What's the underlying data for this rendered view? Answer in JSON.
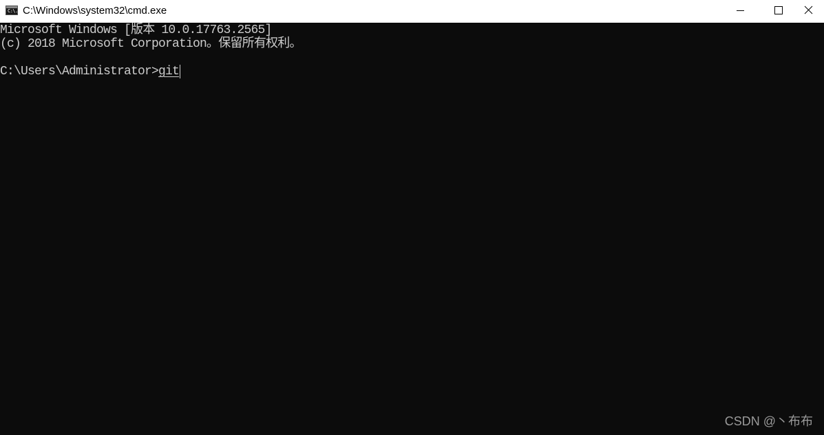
{
  "window": {
    "title": "C:\\Windows\\system32\\cmd.exe",
    "icon": "cmd-icon",
    "icon_text": "C:\\."
  },
  "controls": {
    "minimize_icon": "minimize-icon",
    "maximize_icon": "maximize-icon",
    "close_icon": "close-icon"
  },
  "console": {
    "lines": [
      "Microsoft Windows [版本 10.0.17763.2565]",
      "(c) 2018 Microsoft Corporation。保留所有权利。",
      ""
    ],
    "prompt": "C:\\Users\\Administrator>",
    "input": "git"
  },
  "watermark": "CSDN @丶布布",
  "colors": {
    "console_bg": "#0c0c0c",
    "console_fg": "#cccccc",
    "titlebar_bg": "#ffffff"
  }
}
